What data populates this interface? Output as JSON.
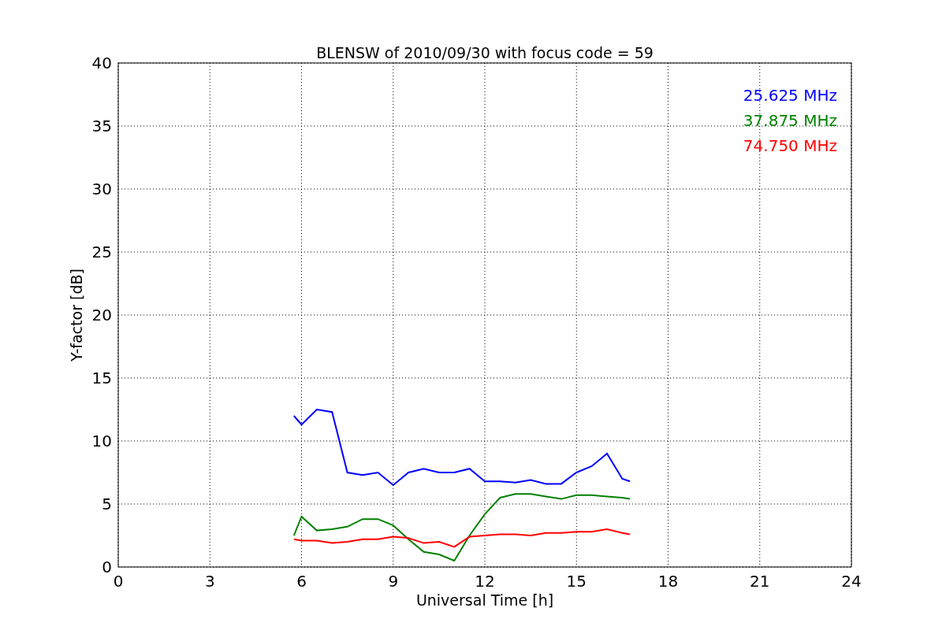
{
  "chart_data": {
    "type": "line",
    "title": "BLENSW of 2010/09/30 with focus code = 59",
    "xlabel": "Universal Time [h]",
    "ylabel": "Y-factor [dB]",
    "x": [
      5.75,
      6,
      6.5,
      7,
      7.5,
      8,
      8.5,
      9,
      9.5,
      10,
      10.5,
      11,
      11.5,
      12,
      12.5,
      13,
      13.5,
      14,
      14.5,
      15,
      15.5,
      16,
      16.5,
      16.75
    ],
    "series": [
      {
        "name": "25.625 MHz",
        "color": "#0000ff",
        "values": [
          12,
          11.3,
          12.5,
          12.3,
          7.5,
          7.3,
          7.5,
          6.5,
          7.5,
          7.8,
          7.5,
          7.5,
          7.8,
          6.8,
          6.8,
          6.7,
          6.9,
          6.6,
          6.6,
          7.5,
          8,
          9,
          7,
          6.8
        ]
      },
      {
        "name": "37.875 MHz",
        "color": "#008000",
        "values": [
          2.5,
          4,
          2.9,
          3,
          3.2,
          3.8,
          3.8,
          3.3,
          2.2,
          1.2,
          1,
          0.5,
          2.5,
          4.2,
          5.5,
          5.8,
          5.8,
          5.6,
          5.4,
          5.7,
          5.7,
          5.6,
          5.5,
          5.4
        ]
      },
      {
        "name": "74.750 MHz",
        "color": "#ff0000",
        "values": [
          2.2,
          2.1,
          2.1,
          1.9,
          2,
          2.2,
          2.2,
          2.4,
          2.3,
          1.9,
          2,
          1.6,
          2.4,
          2.5,
          2.6,
          2.6,
          2.5,
          2.7,
          2.7,
          2.8,
          2.8,
          3,
          2.7,
          2.6
        ]
      }
    ],
    "grid": true,
    "xlim": [
      0,
      24
    ],
    "ylim": [
      0,
      40
    ],
    "xticks": [
      0,
      3,
      6,
      9,
      12,
      15,
      18,
      21,
      24
    ],
    "yticks": [
      0,
      5,
      10,
      15,
      20,
      25,
      30,
      35,
      40
    ]
  }
}
